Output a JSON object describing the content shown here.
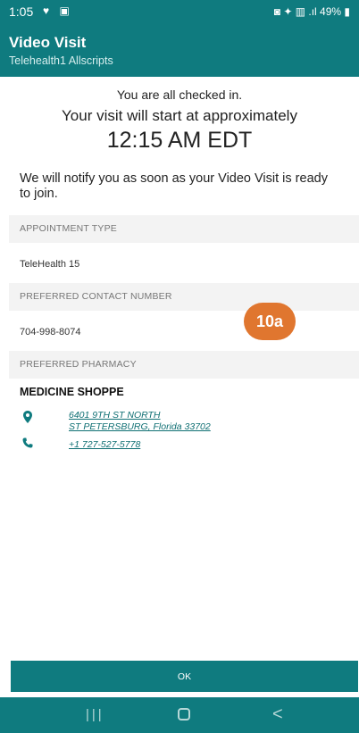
{
  "status_bar": {
    "time": "1:05",
    "left_icons": "♥ ▣",
    "right_icons": "◙ ✦ ▥ .ıl 49% ▮"
  },
  "app_bar": {
    "title": "Video Visit",
    "subtitle": "Telehealth1 Allscripts"
  },
  "checkin": {
    "line1": "You are all checked in.",
    "line2": "Your visit will start at approximately",
    "time": "12:15 AM EDT",
    "notify": "We will notify you as soon as your Video Visit is ready to join."
  },
  "appointment": {
    "header": "APPOINTMENT TYPE",
    "value": "TeleHealth 15"
  },
  "contact": {
    "header": "PREFERRED CONTACT NUMBER",
    "value": "704-998-8074"
  },
  "pharmacy": {
    "header": "PREFERRED PHARMACY",
    "name": "MEDICINE SHOPPE",
    "address_line1": "6401 9TH ST NORTH",
    "address_line2": "ST PETERSBURG, Florida 33702",
    "phone": "+1 727-527-5778"
  },
  "badge": "10a",
  "ok_label": "OK",
  "nav": {
    "recents": "|||",
    "back": "<"
  },
  "colors": {
    "primary": "#0f7b7f",
    "badge": "#e0762f",
    "link": "#0f6f73",
    "section_bg": "#f3f3f3"
  },
  "icons": [
    "heart-icon",
    "image-icon",
    "location-pin-icon",
    "phone-icon"
  ]
}
